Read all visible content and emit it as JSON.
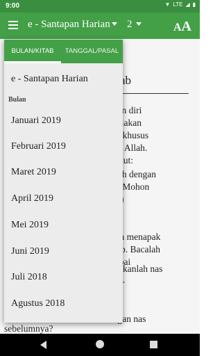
{
  "status": {
    "time": "9:00",
    "network": "LTE"
  },
  "appbar": {
    "book": "e - Santapan Harian",
    "chapter": "2",
    "font_icon": "AA"
  },
  "content": {
    "heading": "i Alkitab",
    "paragraphs": [
      "apkan diri\n, sediakan\nnpat khusus\nngan Allah.\nberikut:",
      "n Roh dengan\ndoa. Mohon\n9:18)",
      "Anda menapak\nlkitab. Bacalah\nsampai",
      "nungkanlah nas\nyaan-\n1:2).\n: hal\ndengan nas",
      "sebelumnya?"
    ]
  },
  "popup": {
    "tabs": [
      "BULAN/KITAB",
      "TANGGAL/PASAL"
    ],
    "top_item": "e - Santapan Harian",
    "section_header": "Bulan",
    "months": [
      "Januari 2019",
      "Februari 2019",
      "Maret 2019",
      "April 2019",
      "Mei 2019",
      "Juni 2019",
      "Juli 2018",
      "Agustus 2018"
    ]
  },
  "colors": {
    "appbar": "#43a047",
    "statusbar": "#3a8e3f"
  }
}
